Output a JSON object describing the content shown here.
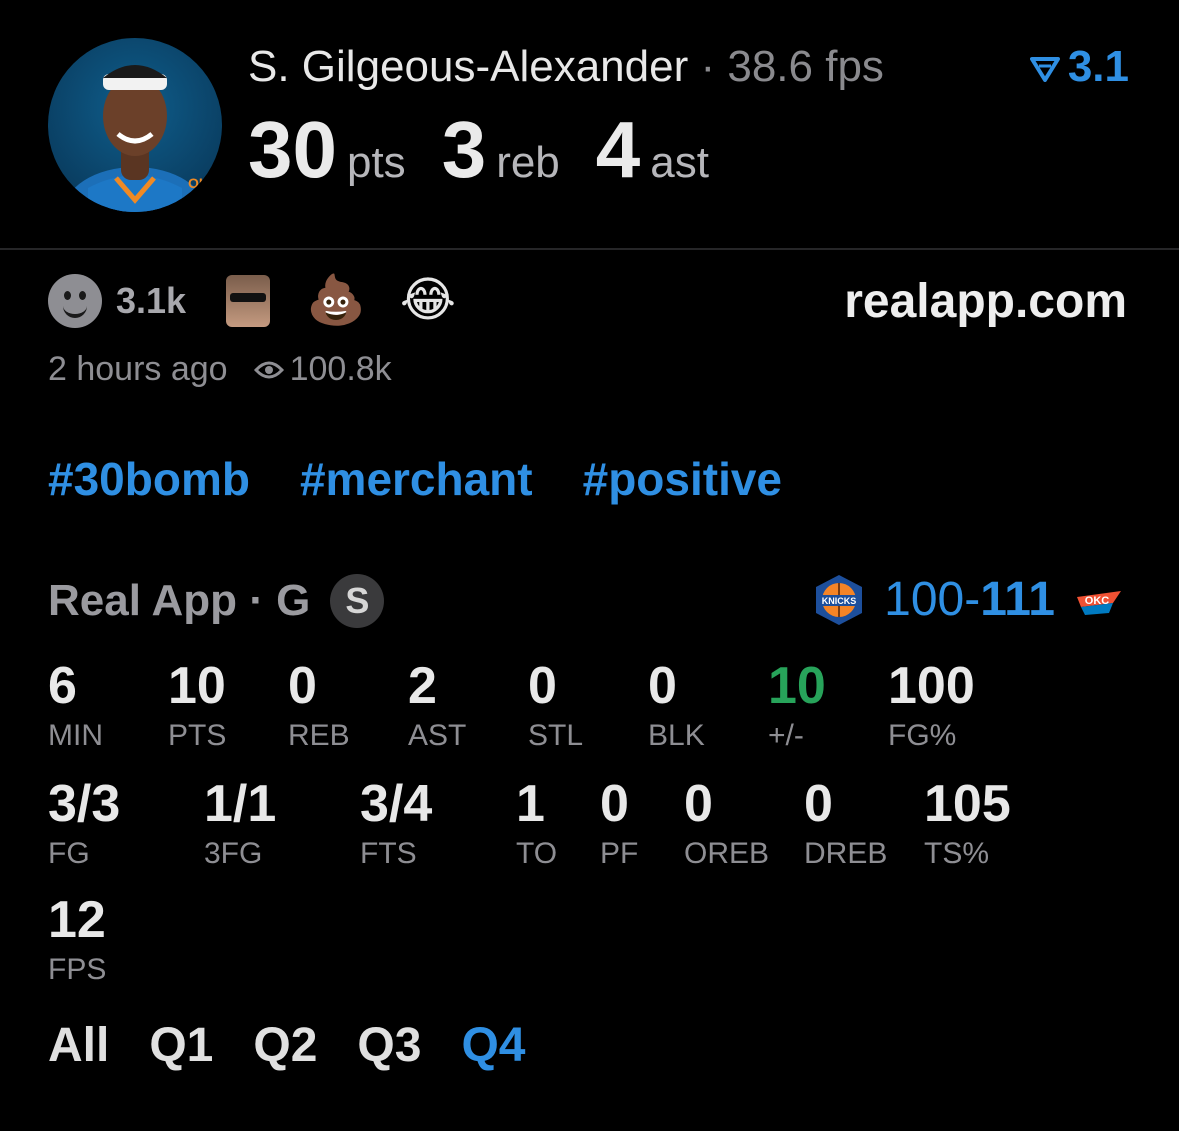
{
  "header": {
    "player_name": "S. Gilgeous-Alexander",
    "separator": " · ",
    "fps_text": "38.6 fps",
    "rating": "3.1",
    "stat_line": [
      {
        "value": "30",
        "unit": "pts"
      },
      {
        "value": "3",
        "unit": "reb"
      },
      {
        "value": "4",
        "unit": "ast"
      }
    ],
    "avatar_badge": "OKC"
  },
  "reactions": {
    "count": "3.1k",
    "emoji_poop": "💩",
    "emoji_laugh": "😂"
  },
  "site": "realapp.com",
  "meta": {
    "time_ago": "2 hours ago",
    "views": "100.8k"
  },
  "hashtags": [
    "#30bomb",
    "#merchant",
    "#positive"
  ],
  "game": {
    "label": "Real App · G",
    "badge": "S",
    "score_home": "100",
    "score_dash": "-",
    "score_away": "111",
    "home_team": "KNICKS",
    "away_team": "OKC"
  },
  "stats": [
    {
      "value": "6",
      "label": "MIN"
    },
    {
      "value": "10",
      "label": "PTS"
    },
    {
      "value": "0",
      "label": "REB"
    },
    {
      "value": "2",
      "label": "AST"
    },
    {
      "value": "0",
      "label": "STL"
    },
    {
      "value": "0",
      "label": "BLK"
    },
    {
      "value": "10",
      "label": "+/-"
    },
    {
      "value": "100",
      "label": "FG%"
    },
    {
      "value": "3/3",
      "label": "FG"
    },
    {
      "value": "1/1",
      "label": "3FG"
    },
    {
      "value": "3/4",
      "label": "FTS"
    },
    {
      "value": "1",
      "label": "TO"
    },
    {
      "value": "0",
      "label": "PF"
    },
    {
      "value": "0",
      "label": "OREB"
    },
    {
      "value": "0",
      "label": "DREB"
    },
    {
      "value": "105",
      "label": "TS%"
    },
    {
      "value": "12",
      "label": "FPS"
    }
  ],
  "quarters": [
    "All",
    "Q1",
    "Q2",
    "Q3",
    "Q4"
  ],
  "active_quarter": "Q4",
  "colors": {
    "accent": "#2f8fe3",
    "positive": "#27a35a",
    "muted": "#8e8e93"
  }
}
